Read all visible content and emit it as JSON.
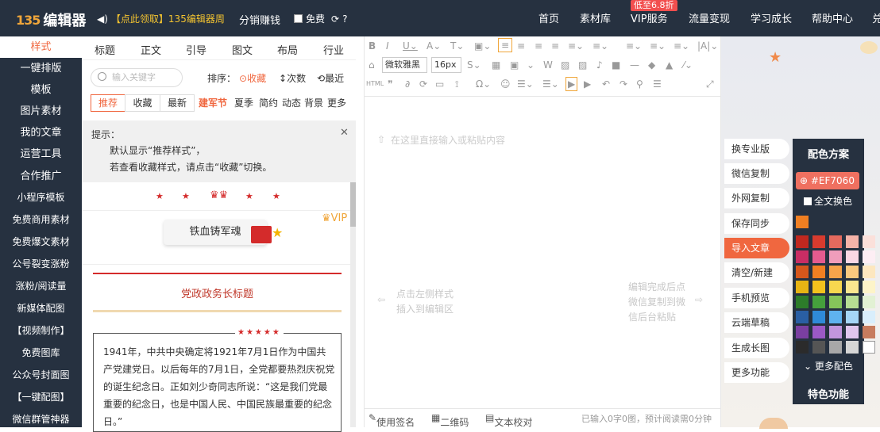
{
  "topbar": {
    "logo_mark": "135",
    "logo_text": "编辑器",
    "promo": "【点此领取】135编辑器周",
    "distrib": "分销赚钱",
    "free": "免费",
    "nav": [
      "首页",
      "素材库",
      "VIP服务",
      "流量变现",
      "学习成长",
      "帮助中心",
      "兑"
    ],
    "vip_badge": "低至6.8折"
  },
  "leftnav": {
    "items": [
      "样式",
      "一键排版",
      "模板",
      "图片素材",
      "我的文章",
      "运营工具",
      "合作推广",
      "小程序模板",
      "免费商用素材",
      "免费爆文素材",
      "公号裂变涨粉",
      "涨粉/阅读量",
      "新媒体配图",
      "【视频制作】",
      "免费图库",
      "公众号封面图",
      "【一键配图】",
      "微信群管神器"
    ]
  },
  "stylepanel": {
    "tabs": [
      "标题",
      "正文",
      "引导",
      "图文",
      "布局",
      "行业"
    ],
    "search_placeholder": "输入关键字",
    "sort_label": "排序：",
    "sort_options": [
      "收藏",
      "次数",
      "最近"
    ],
    "subtabs": [
      "推荐",
      "收藏",
      "最新"
    ],
    "categories": [
      "建军节",
      "夏季",
      "简约",
      "动态",
      "背景",
      "更多"
    ],
    "tip_title": "提示：",
    "tip_line1": "默认显示“推荐样式”，",
    "tip_line2": "若查看收藏样式，请点击“收藏”切换。",
    "sample2_title": "铁血铸军魂",
    "vip": "VIP",
    "sample3_title": "党政政务长标题",
    "sample4_text": "1941年，中共中央确定将1921年7月1日作为中国共产党建党日。以后每年的7月1日，全党都要热烈庆祝党的诞生纪念日。正如刘少奇同志所说：“这是我们党最重要的纪念日，也是中国人民、中国民族最重要的纪念日。”"
  },
  "editor": {
    "font_family": "微软雅黑",
    "font_size": "16px",
    "placeholder": "在这里直接输入或粘贴内容",
    "hint_left_line1": "点击左侧样式",
    "hint_left_line2": "插入到编辑区",
    "hint_right_line1": "编辑完成后点",
    "hint_right_line2": "微信复制到微",
    "hint_right_line3": "信后台粘贴",
    "bottom": [
      "使用签名",
      "二维码",
      "文本校对"
    ],
    "status": "已输入0字0图，预计阅读需0分钟"
  },
  "rightpanel": {
    "buttons": [
      "换专业版",
      "微信复制",
      "外网复制",
      "保存同步",
      "导入文章",
      "清空/新建",
      "手机预览",
      "云端草稿",
      "生成长图",
      "更多功能"
    ],
    "color_title": "配色方案",
    "color_hex": "#EF7060",
    "all_color": "全文换色",
    "more_colors": "更多配色",
    "special": "特色功能",
    "current_color": "#f07f22",
    "swatches": [
      "#c0281f",
      "#d83b2e",
      "#e56a5e",
      "#f5b3a8",
      "#fbe0da",
      "#c92d64",
      "#e45b8f",
      "#f09dbb",
      "#fad7e4",
      "#fdeef4",
      "#d6571c",
      "#f07f22",
      "#f6a44b",
      "#fac97f",
      "#fde7bf",
      "#e7b414",
      "#f2c21d",
      "#f7d74f",
      "#fae68f",
      "#fdf4c9",
      "#2d7c2a",
      "#45a03c",
      "#86c45a",
      "#b7dd93",
      "#e2f1d4",
      "#2a5fa4",
      "#2f8ad8",
      "#5fb3ef",
      "#a5d6f7",
      "#d9eefc",
      "#7a3fa1",
      "#9b59c6",
      "#c296dd",
      "#e0c6ee",
      "#c77c5e",
      "#2b2b2b",
      "#555555",
      "#a8a8a8",
      "#d6d6d6",
      "#ffffff"
    ]
  }
}
